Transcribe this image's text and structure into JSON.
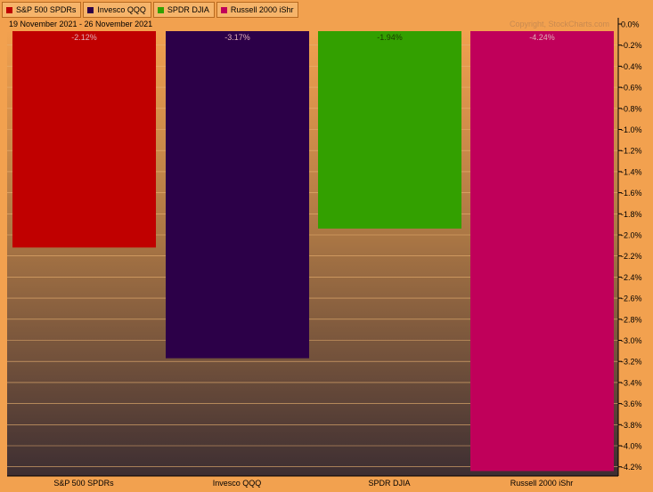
{
  "legend": [
    {
      "label": "S&P 500 SPDRs",
      "color": "#c00000"
    },
    {
      "label": "Invesco QQQ",
      "color": "#2c0048"
    },
    {
      "label": "SPDR DJIA",
      "color": "#33a000"
    },
    {
      "label": "Russell 2000 iShr",
      "color": "#c0005a"
    }
  ],
  "header": {
    "date_range": "19 November 2021 - 26 November 2021",
    "copyright": "Copyright, StockCharts.com"
  },
  "chart_data": {
    "type": "bar",
    "categories": [
      "S&P 500 SPDRs",
      "Invesco QQQ",
      "SPDR DJIA",
      "Russell 2000 iShr"
    ],
    "values": [
      -2.12,
      -3.17,
      -1.94,
      -4.24
    ],
    "value_labels": [
      "-2.12%",
      "-3.17%",
      "-1.94%",
      "-4.24%"
    ],
    "colors": [
      "#c00000",
      "#2c0048",
      "#33a000",
      "#c0005a"
    ],
    "ylim": [
      -4.3,
      0.0
    ],
    "y_ticks": [
      "0.0%",
      "-0.2%",
      "-0.4%",
      "-0.6%",
      "-0.8%",
      "-1.0%",
      "-1.2%",
      "-1.4%",
      "-1.6%",
      "-1.8%",
      "-2.0%",
      "-2.2%",
      "-2.4%",
      "-2.6%",
      "-2.8%",
      "-3.0%",
      "-3.2%",
      "-3.4%",
      "-3.6%",
      "-3.8%",
      "-4.0%",
      "-4.2%"
    ],
    "y_tick_values": [
      0,
      -0.2,
      -0.4,
      -0.6,
      -0.8,
      -1.0,
      -1.2,
      -1.4,
      -1.6,
      -1.8,
      -2.0,
      -2.2,
      -2.4,
      -2.6,
      -2.8,
      -3.0,
      -3.2,
      -3.4,
      -3.6,
      -3.8,
      -4.0,
      -4.2
    ],
    "axis_side": "right",
    "grid": true
  }
}
